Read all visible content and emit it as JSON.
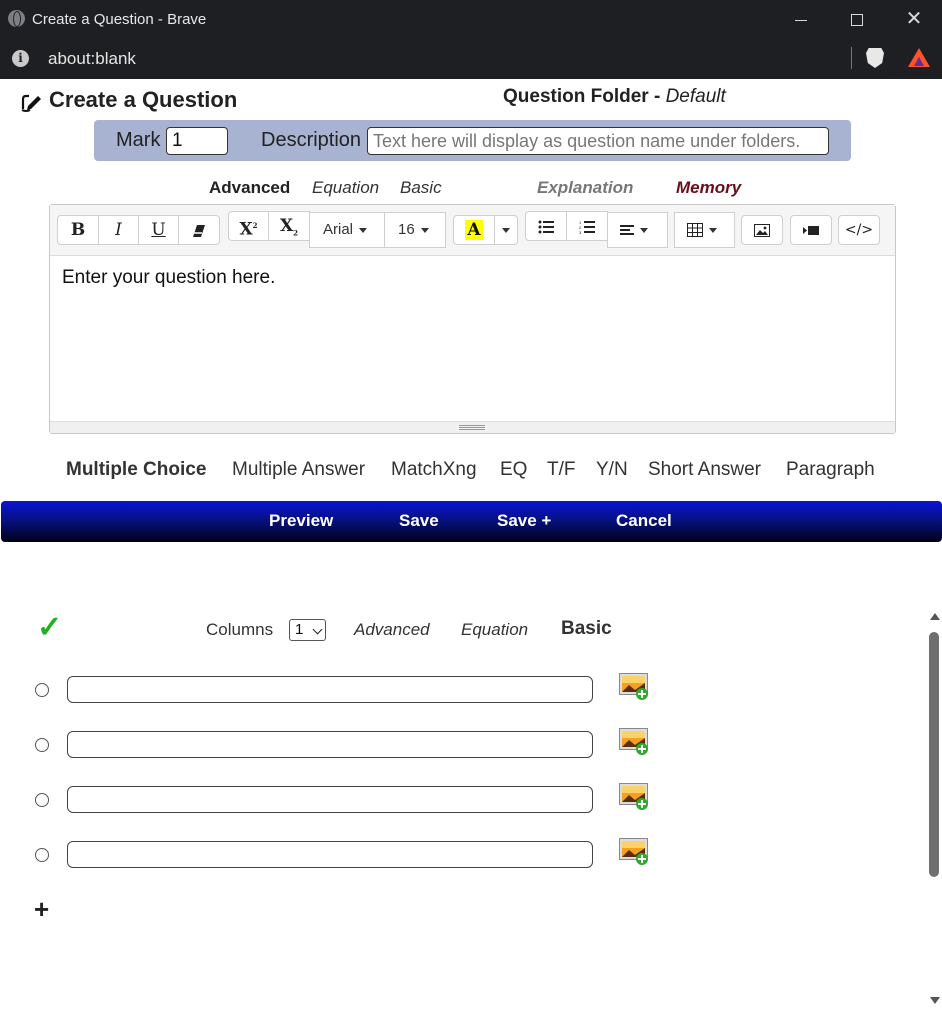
{
  "browser": {
    "window_title": "Create a Question - Brave",
    "url": "about:blank"
  },
  "header": {
    "title": "Create a Question",
    "folder_label": "Question Folder - ",
    "folder_value": "Default"
  },
  "mark_bar": {
    "mark_label": "Mark",
    "mark_value": "1",
    "description_label": "Description",
    "description_placeholder": "Text here will display as question name under folders."
  },
  "editor_modes": {
    "advanced": "Advanced",
    "equation": "Equation",
    "basic": "Basic",
    "explanation": "Explanation",
    "memory": "Memory",
    "memory_color": "#6b0d1a"
  },
  "toolbar": {
    "bold": "B",
    "italic": "I",
    "underline": "U",
    "superscript": "X",
    "subscript": "X",
    "font_family": "Arial",
    "font_size": "16",
    "font_color": "A",
    "code_view": "</>"
  },
  "editor": {
    "content": "Enter your question here."
  },
  "question_types": [
    "Multiple Choice",
    "Multiple Answer",
    "MatchXng",
    "EQ",
    "T/F",
    "Y/N",
    "Short Answer",
    "Paragraph"
  ],
  "actions": {
    "preview": "Preview",
    "save": "Save",
    "save_plus": "Save +",
    "cancel": "Cancel"
  },
  "answers": {
    "columns_label": "Columns",
    "columns_value": "1",
    "advanced": "Advanced",
    "equation": "Equation",
    "basic": "Basic",
    "rows": [
      "",
      "",
      "",
      ""
    ],
    "add_symbol": "+"
  },
  "colors": {
    "action_bar_top": "#0a14d6",
    "mark_bar_bg": "#a7b3d1",
    "check_green": "#22b022"
  }
}
